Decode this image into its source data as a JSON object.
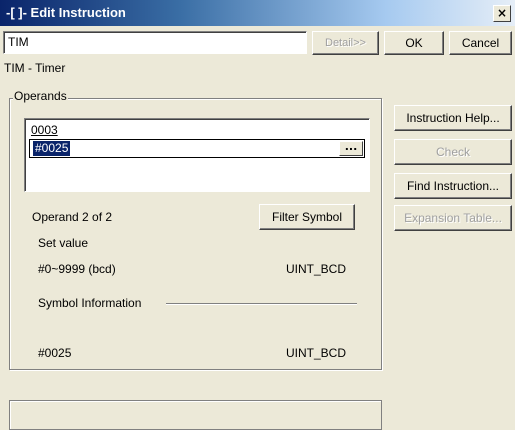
{
  "window": {
    "title": "-[ ]- Edit Instruction",
    "close_glyph": "×"
  },
  "instruction": {
    "value": "TIM",
    "detail_label": "Detail>>",
    "ok_label": "OK",
    "cancel_label": "Cancel",
    "description": "TIM - Timer"
  },
  "operands": {
    "group_label": "Operands",
    "list": [
      "0003",
      "#0025"
    ],
    "browse_label": "...",
    "position_text": "Operand 2 of 2",
    "filter_label": "Filter Symbol",
    "set_value_label": "Set value",
    "range": "#0~9999 (bcd)",
    "data_type": "UINT_BCD",
    "symbol_info_label": "Symbol Information",
    "symbol_value": "#0025",
    "symbol_type": "UINT_BCD"
  },
  "side_buttons": {
    "help": "Instruction Help...",
    "check": "Check",
    "find": "Find Instruction...",
    "expansion": "Expansion Table..."
  }
}
